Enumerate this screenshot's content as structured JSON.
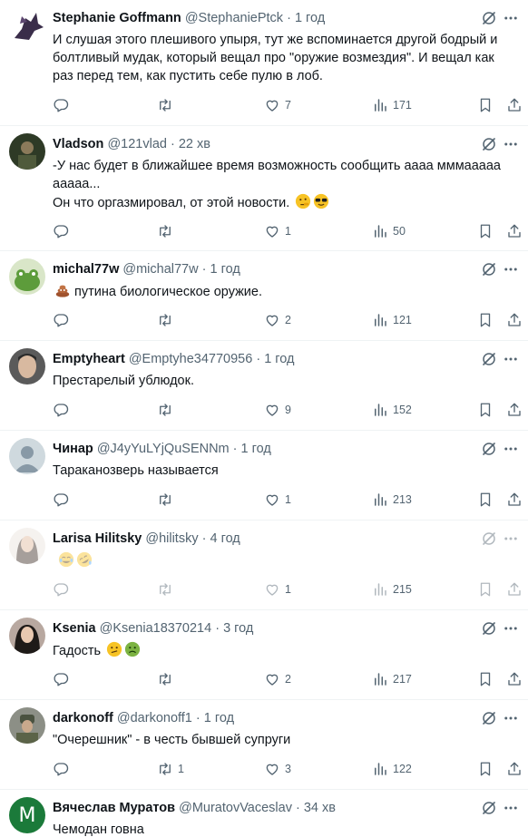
{
  "colors": {
    "text": "#0f1419",
    "secondary": "#536471",
    "divider": "#eff3f4",
    "background": "#ffffff"
  },
  "icons": [
    "reply-icon",
    "retweet-icon",
    "like-icon",
    "views-icon",
    "bookmark-icon",
    "share-icon",
    "grok-icon",
    "more-icon"
  ],
  "tweets": [
    {
      "name": "Stephanie Goffmann",
      "handle": "@StephaniePtck",
      "sep": "·",
      "time": "1 год",
      "text": "И слушая этого плешивого упыря, тут же вспоминается другой бодрый и болтливый мудак, который вещал про \"оружие возмездия\". И вещал как раз перед тем, как пустить себе пулю в лоб.",
      "emojis": [],
      "replies": "",
      "retweets": "",
      "likes": "7",
      "views": "171",
      "avatar": "dragon"
    },
    {
      "name": "Vladson",
      "handle": "@121vlad",
      "sep": "·",
      "time": "22 хв",
      "text": "-У нас будет в ближайшее время возможность сообщить аааа мммааааа ааааа...\nОн что оргазмировал, от этой новости.",
      "emojis": [
        "thinking-face",
        "sunglasses-face"
      ],
      "replies": "",
      "retweets": "",
      "likes": "1",
      "views": "50",
      "avatar": "photo-dark"
    },
    {
      "name": "michal77w",
      "handle": "@michal77w",
      "sep": "·",
      "time": "1 год",
      "text": "путина биологическое оружие.",
      "emojis_before": [
        "poo"
      ],
      "emojis": [],
      "replies": "",
      "retweets": "",
      "likes": "2",
      "views": "121",
      "avatar": "frog"
    },
    {
      "name": "Emptyheart",
      "handle": "@Emptyhe34770956",
      "sep": "·",
      "time": "1 год",
      "text": "Престарелый ублюдок.",
      "emojis": [],
      "replies": "",
      "retweets": "",
      "likes": "9",
      "views": "152",
      "avatar": "face"
    },
    {
      "name": "Чинар",
      "handle": "@J4yYuLYjQuSENNm",
      "sep": "·",
      "time": "1 год",
      "text": "Тараканозверь называется",
      "emojis": [],
      "replies": "",
      "retweets": "",
      "likes": "1",
      "views": "213",
      "avatar": "default"
    },
    {
      "name": "Larisa Hilitsky",
      "handle": "@hilitsky",
      "sep": "·",
      "time": "4 год",
      "text": "",
      "emojis": [
        "tears-of-joy",
        "rofl"
      ],
      "replies": "",
      "retweets": "",
      "likes": "1",
      "views": "215",
      "avatar": "woman",
      "faded": true
    },
    {
      "name": "Ksenia",
      "handle": "@Ksenia18370214",
      "sep": "·",
      "time": "3 год",
      "text": "Гадость",
      "emojis": [
        "confused-face",
        "nauseated-face"
      ],
      "replies": "",
      "retweets": "",
      "likes": "2",
      "views": "217",
      "avatar": "woman2"
    },
    {
      "name": "darkonoff",
      "handle": "@darkonoff1",
      "sep": "·",
      "time": "1 год",
      "text": "\"Очерешник\" - в честь бывшей супруги",
      "emojis": [],
      "replies": "",
      "retweets": "1",
      "likes": "3",
      "views": "122",
      "avatar": "soldier"
    },
    {
      "name": "Вячеслав Муратов",
      "handle": "@MuratovVaceslav",
      "sep": "·",
      "time": "34 хв",
      "text": "Чемодан говна",
      "emojis": [],
      "replies": "",
      "retweets": "",
      "likes": "",
      "views": "",
      "avatar": "letter-m",
      "avatar_letter": "M"
    }
  ]
}
